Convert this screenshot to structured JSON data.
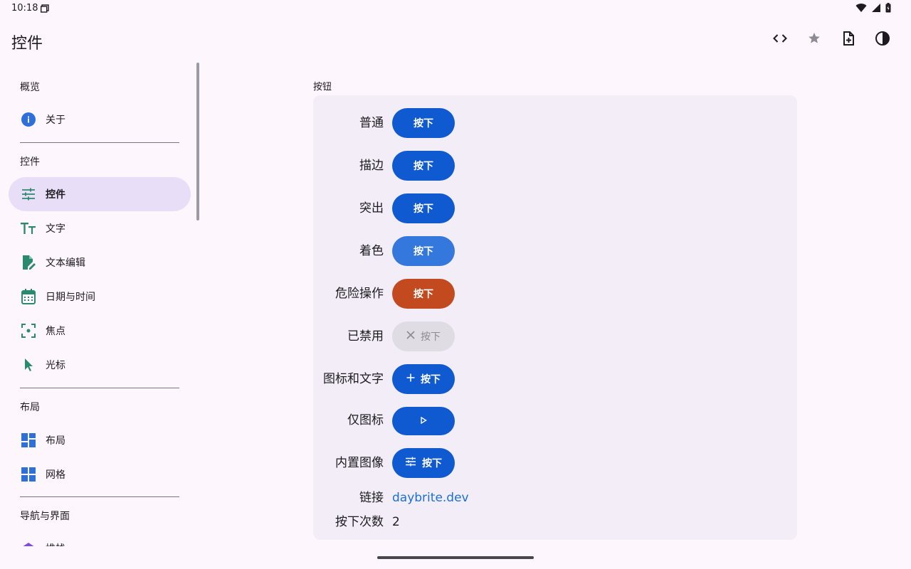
{
  "status_bar": {
    "time": "10:18"
  },
  "app_bar": {
    "title": "控件",
    "actions": [
      "code-icon",
      "star-icon",
      "add-file-icon",
      "theme-toggle-icon"
    ]
  },
  "sidebar": {
    "sections": [
      {
        "header": "概览",
        "items": [
          {
            "label": "关于",
            "icon": "info-icon"
          }
        ]
      },
      {
        "header": "控件",
        "items": [
          {
            "label": "控件",
            "icon": "tune-icon",
            "selected": true
          },
          {
            "label": "文字",
            "icon": "text-size-icon"
          },
          {
            "label": "文本编辑",
            "icon": "edit-document-icon"
          },
          {
            "label": "日期与时间",
            "icon": "calendar-icon"
          },
          {
            "label": "焦点",
            "icon": "focus-icon"
          },
          {
            "label": "光标",
            "icon": "cursor-icon"
          }
        ]
      },
      {
        "header": "布局",
        "items": [
          {
            "label": "布局",
            "icon": "layout-icon"
          },
          {
            "label": "网格",
            "icon": "grid-icon"
          }
        ]
      },
      {
        "header": "导航与界面",
        "items": [
          {
            "label": "堆栈",
            "icon": "stack-icon"
          }
        ]
      }
    ]
  },
  "main": {
    "section_title": "按钮",
    "rows": [
      {
        "label": "普通",
        "button": "按下"
      },
      {
        "label": "描边",
        "button": "按下"
      },
      {
        "label": "突出",
        "button": "按下"
      },
      {
        "label": "着色",
        "button": "按下"
      },
      {
        "label": "危险操作",
        "button": "按下"
      },
      {
        "label": "已禁用",
        "button": "按下"
      },
      {
        "label": "图标和文字",
        "button": "按下"
      },
      {
        "label": "仅图标"
      },
      {
        "label": "内置图像",
        "button": "按下"
      }
    ],
    "link": {
      "label": "链接",
      "text": "daybrite.dev"
    },
    "press_count": {
      "label": "按下次数",
      "value": "2"
    }
  },
  "colors": {
    "primary": "#0f5ad0",
    "tinted": "#3478de",
    "danger": "#c34a1e",
    "disabled": "#e0dce4",
    "selected_nav": "#e8def8",
    "icon_teal": "#2b8a6e"
  }
}
